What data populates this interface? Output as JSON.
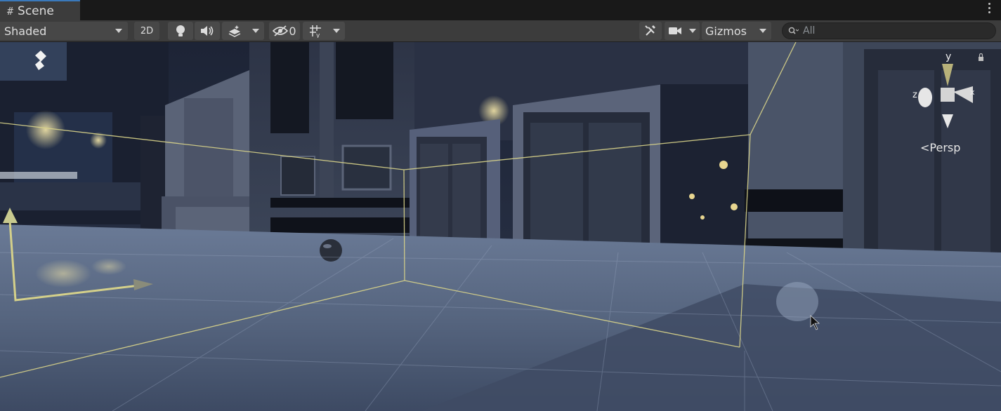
{
  "tab": {
    "label": "Scene",
    "icon": "grid-hash-icon"
  },
  "toolbar": {
    "shading_mode": "Shaded",
    "mode_2d_label": "2D",
    "hidden_count": "0",
    "gizmos_label": "Gizmos",
    "search_placeholder": "All"
  },
  "gizmo": {
    "axis_y": "y",
    "axis_z": "z",
    "axis_x": "x",
    "projection_label": "Persp"
  },
  "colors": {
    "accent_tab": "#3a79bb",
    "toolbar_bg": "#3c3c3c",
    "scene_floor": "#5b6a86",
    "bounds_line": "#d9d48a"
  }
}
